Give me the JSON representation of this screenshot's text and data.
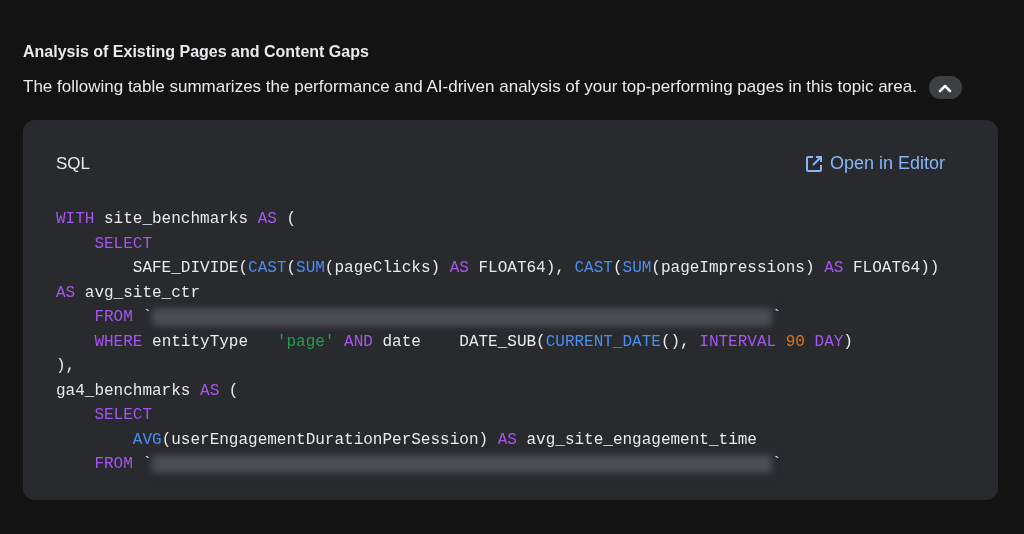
{
  "heading": "Analysis of Existing Pages and Content Gaps",
  "intro": "The following table summarizes the performance and AI-driven analysis of your top-performing pages in this topic area.",
  "collapse_button": {
    "expanded": true
  },
  "code_block": {
    "language": "SQL",
    "open_link": "Open in Editor",
    "lines": [
      [
        {
          "kind": "keyword",
          "text": "WITH"
        },
        {
          "kind": "plain",
          "text": " site_benchmarks "
        },
        {
          "kind": "keyword",
          "text": "AS"
        },
        {
          "kind": "plain",
          "text": " ("
        }
      ],
      [
        {
          "kind": "keyword",
          "text": "    SELECT"
        }
      ],
      [
        {
          "kind": "plain",
          "text": "        SAFE_DIVIDE("
        },
        {
          "kind": "function",
          "text": "CAST"
        },
        {
          "kind": "plain",
          "text": "("
        },
        {
          "kind": "function",
          "text": "SUM"
        },
        {
          "kind": "plain",
          "text": "(pageClicks) "
        },
        {
          "kind": "keyword",
          "text": "AS"
        },
        {
          "kind": "plain",
          "text": " FLOAT64), "
        },
        {
          "kind": "function",
          "text": "CAST"
        },
        {
          "kind": "plain",
          "text": "("
        },
        {
          "kind": "function",
          "text": "SUM"
        },
        {
          "kind": "plain",
          "text": "(pageImpressions) "
        },
        {
          "kind": "keyword",
          "text": "AS"
        },
        {
          "kind": "plain",
          "text": " FLOAT64))"
        }
      ],
      [
        {
          "kind": "keyword",
          "text": "AS"
        },
        {
          "kind": "plain",
          "text": " avg_site_ctr"
        }
      ],
      [
        {
          "kind": "keyword",
          "text": "    FROM"
        },
        {
          "kind": "plain",
          "text": " `"
        },
        {
          "kind": "redacted"
        },
        {
          "kind": "plain",
          "text": "`"
        }
      ],
      [
        {
          "kind": "keyword",
          "text": "    WHERE"
        },
        {
          "kind": "plain",
          "text": " entityType   "
        },
        {
          "kind": "string",
          "text": "'page'"
        },
        {
          "kind": "keyword",
          "text": " AND"
        },
        {
          "kind": "plain",
          "text": " date    DATE_SUB("
        },
        {
          "kind": "function",
          "text": "CURRENT_DATE"
        },
        {
          "kind": "plain",
          "text": "(), "
        },
        {
          "kind": "keyword",
          "text": "INTERVAL"
        },
        {
          "kind": "number",
          "text": " 90"
        },
        {
          "kind": "keyword",
          "text": " DAY"
        },
        {
          "kind": "plain",
          "text": ")"
        }
      ],
      [
        {
          "kind": "plain",
          "text": "),"
        }
      ],
      [
        {
          "kind": "plain",
          "text": "ga4_benchmarks "
        },
        {
          "kind": "keyword",
          "text": "AS"
        },
        {
          "kind": "plain",
          "text": " ("
        }
      ],
      [
        {
          "kind": "keyword",
          "text": "    SELECT"
        }
      ],
      [
        {
          "kind": "function",
          "text": "        AVG"
        },
        {
          "kind": "plain",
          "text": "(userEngagementDurationPerSession) "
        },
        {
          "kind": "keyword",
          "text": "AS"
        },
        {
          "kind": "plain",
          "text": " avg_site_engagement_time"
        }
      ],
      [
        {
          "kind": "keyword",
          "text": "    FROM"
        },
        {
          "kind": "plain",
          "text": " `"
        },
        {
          "kind": "redacted"
        },
        {
          "kind": "plain",
          "text": "`"
        }
      ]
    ]
  }
}
